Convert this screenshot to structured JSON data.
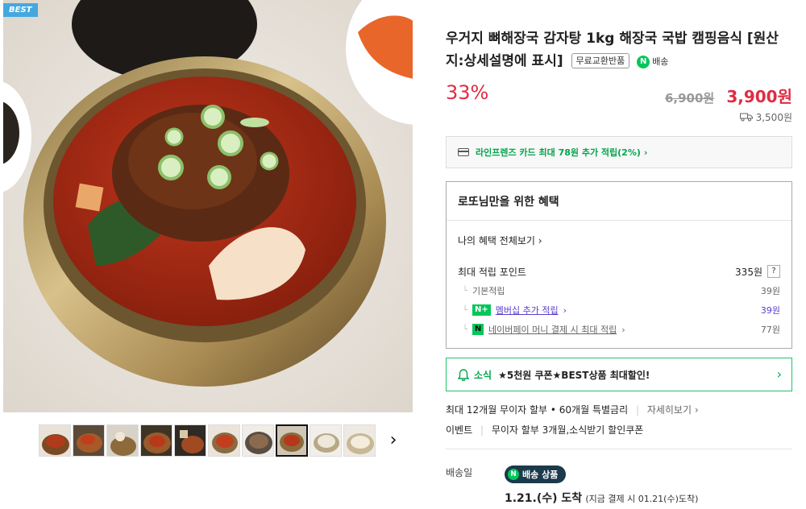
{
  "badge": "BEST",
  "product": {
    "title": "우거지 뼈해장국 감자탕 1kg 해장국 국밥 캠핑음식 [원산지:상세설명에 표시]",
    "tag_return": "무료교환반품",
    "tag_delivery": "배송",
    "n_letter": "N"
  },
  "price": {
    "discount": "33%",
    "original": "6,900원",
    "sale": "3,900원",
    "shipping": "3,500원"
  },
  "card": {
    "text": "라인프렌즈 카드 최대 78원 추가 적립(2%)"
  },
  "benefit": {
    "title": "로또님만을 위한 혜택",
    "my_link": "나의 혜택 전체보기",
    "max_label": "최대 적립 포인트",
    "max_value": "335원",
    "help": "?",
    "rows": [
      {
        "label": "기본적립",
        "value": "39원"
      },
      {
        "badge": "N+",
        "label": "멤버십 추가 적립",
        "value": "39원"
      },
      {
        "badge": "N",
        "label": "네이버페이 머니 결제 시 최대 적립",
        "value": "77원"
      }
    ]
  },
  "news": {
    "label": "소식",
    "text": "★5천원 쿠폰★BEST상품 최대할인!"
  },
  "installment": {
    "text": "최대 12개월 무이자 할부 • 60개월 특별금리",
    "more": "자세히보기"
  },
  "event": {
    "label": "이벤트",
    "text": "무이자 할부 3개월,소식받기 할인쿠폰"
  },
  "delivery": {
    "label": "배송일",
    "badge": "배송 상품",
    "arrival": "1.21.(수) 도착",
    "note": "(지금 결제 시 01.21(수)도착)"
  },
  "thumb_count": 10,
  "colors": {
    "accent_red": "#e02c43",
    "naver_green": "#03c75a",
    "best_blue": "#44a8e0"
  }
}
